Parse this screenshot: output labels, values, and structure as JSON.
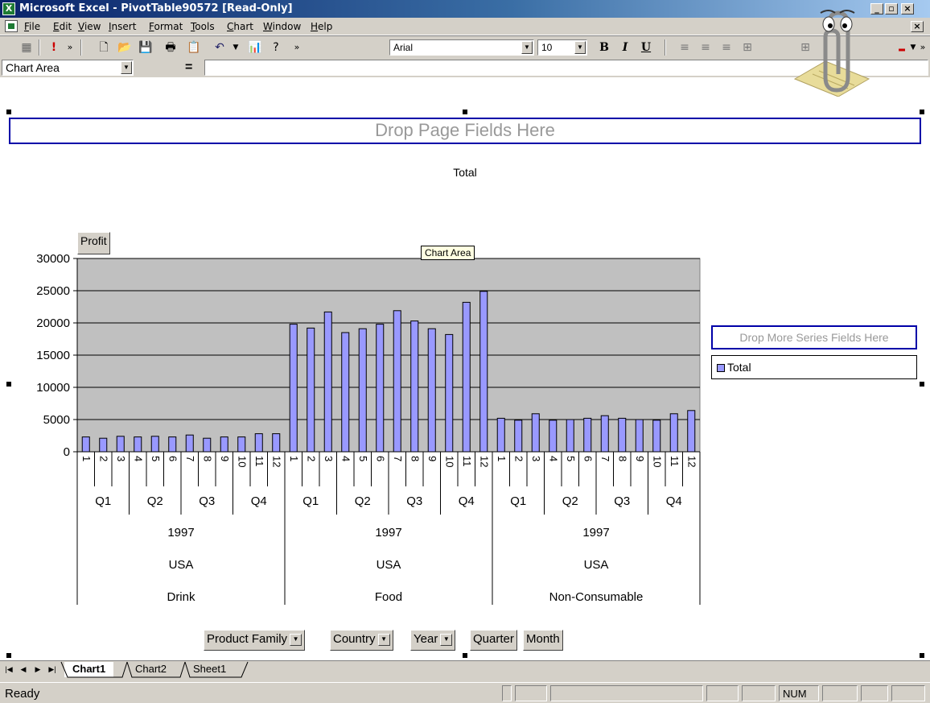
{
  "window": {
    "title": "Microsoft Excel - PivotTable90572  [Read-Only]",
    "minimize": "_",
    "restore": "▫",
    "close": "×"
  },
  "menu": [
    "File",
    "Edit",
    "View",
    "Insert",
    "Format",
    "Tools",
    "Chart",
    "Window",
    "Help"
  ],
  "toolbar": {
    "font": "Arial",
    "size": "10",
    "bold": "B",
    "italic": "I",
    "underline": "U"
  },
  "namebox": {
    "value": "Chart Area",
    "equals": "="
  },
  "chart": {
    "page_drop": "Drop Page Fields Here",
    "tooltip": "Chart Area",
    "value_field": "Profit",
    "series_drop": "Drop More Series Fields Here",
    "legend_entry": "Total",
    "category_buttons": [
      "Product Family",
      "Country",
      "Year",
      "Quarter",
      "Month"
    ]
  },
  "chart_data": {
    "type": "bar",
    "title": "Total",
    "ylim": [
      0,
      30000
    ],
    "yticks": [
      0,
      5000,
      10000,
      15000,
      20000,
      25000,
      30000
    ],
    "grid": true,
    "legend": "right",
    "months": [
      "1",
      "2",
      "3",
      "4",
      "5",
      "6",
      "7",
      "8",
      "9",
      "10",
      "11",
      "12"
    ],
    "quarters": [
      "Q1",
      "Q2",
      "Q3",
      "Q4"
    ],
    "groups": [
      {
        "family": "Drink",
        "country": "USA",
        "year": "1997",
        "values": [
          2300,
          2100,
          2400,
          2300,
          2400,
          2300,
          2600,
          2100,
          2300,
          2300,
          2800,
          2800
        ]
      },
      {
        "family": "Food",
        "country": "USA",
        "year": "1997",
        "values": [
          19800,
          19200,
          21700,
          18500,
          19100,
          19800,
          21900,
          20300,
          19100,
          18200,
          23200,
          24900
        ]
      },
      {
        "family": "Non-Consumable",
        "country": "USA",
        "year": "1997",
        "values": [
          5200,
          4900,
          5900,
          4900,
          5000,
          5200,
          5600,
          5200,
          5000,
          4900,
          5900,
          6400
        ]
      }
    ],
    "series": [
      {
        "name": "Total"
      }
    ]
  },
  "sheets": {
    "tabs": [
      "Chart1",
      "Chart2",
      "Sheet1"
    ],
    "active": "Chart1"
  },
  "status": {
    "text": "Ready",
    "num": "NUM"
  },
  "colors": {
    "bar": "#9999ff",
    "plot_area": "#c0c0c0",
    "titlebar": "#0a246a"
  }
}
